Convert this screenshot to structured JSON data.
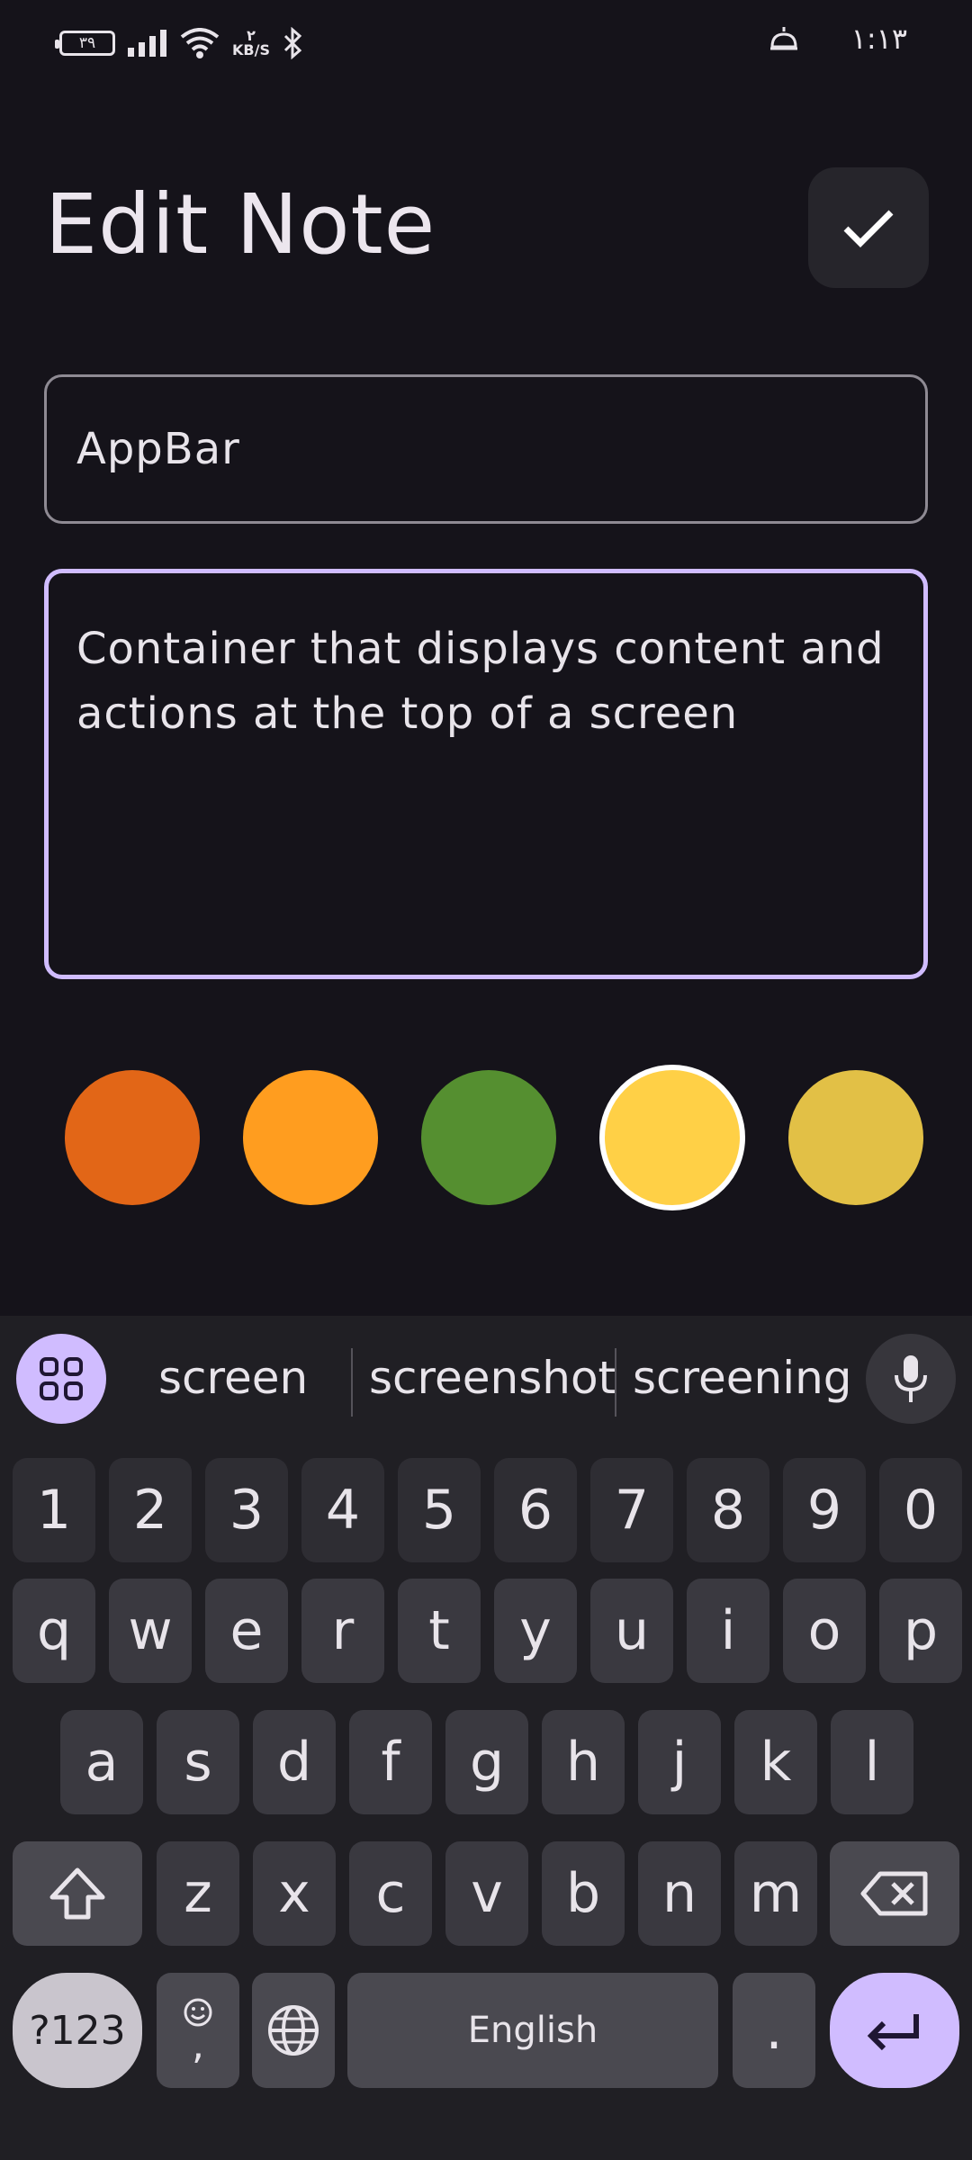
{
  "status_bar": {
    "battery": "۳۹",
    "data_rate_value": "۲",
    "data_rate_unit": "KB/S",
    "time": "۱:۱۳"
  },
  "header": {
    "title": "Edit Note"
  },
  "form": {
    "title_value": "AppBar",
    "body_value": "Container that displays content and actions at the top of a screen"
  },
  "colors": [
    "#e26617",
    "#ff9d1f",
    "#558f30",
    "#ffd046",
    "#e2c046"
  ],
  "selected_color_index": 3,
  "keyboard": {
    "suggestions": [
      "screen",
      "screenshot",
      "screening"
    ],
    "row_numbers": [
      "1",
      "2",
      "3",
      "4",
      "5",
      "6",
      "7",
      "8",
      "9",
      "0"
    ],
    "row1": [
      "q",
      "w",
      "e",
      "r",
      "t",
      "y",
      "u",
      "i",
      "o",
      "p"
    ],
    "row2": [
      "a",
      "s",
      "d",
      "f",
      "g",
      "h",
      "j",
      "k",
      "l"
    ],
    "row3": [
      "z",
      "x",
      "c",
      "v",
      "b",
      "n",
      "m"
    ],
    "symbols_label": "?123",
    "comma_label": ",",
    "space_label": "English",
    "period_label": "."
  }
}
